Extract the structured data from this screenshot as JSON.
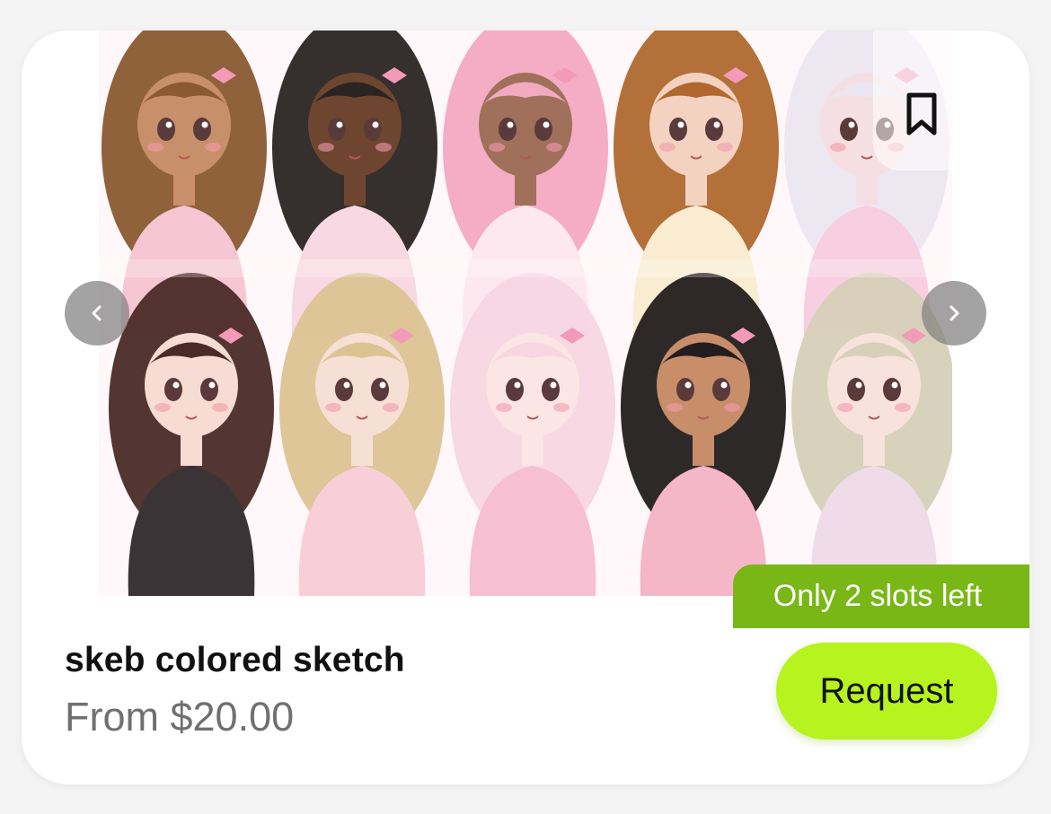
{
  "listing": {
    "title": "skeb colored sketch",
    "price": "From $20.00",
    "slots_badge": "Only 2 slots left",
    "request_label": "Request"
  },
  "icons": {
    "bookmark": "bookmark-icon",
    "prev": "chevron-left-icon",
    "next": "chevron-right-icon"
  },
  "colors": {
    "badge": "#78b716",
    "request": "#b6f31f",
    "nav": "#808080"
  },
  "gallery": {
    "characters": [
      {
        "hair": "#8a5a32",
        "skin": "#c8906a",
        "outfit": "#f6c6d4"
      },
      {
        "hair": "#2a2422",
        "skin": "#6e4630",
        "outfit": "#f8d8e2"
      },
      {
        "hair": "#f3a9c2",
        "skin": "#a0705a",
        "outfit": "#fde8ef"
      },
      {
        "hair": "#b0682e",
        "skin": "#f4d2c2",
        "outfit": "#f9ecd0"
      },
      {
        "hair": "#ece6f1",
        "skin": "#f6dfe2",
        "outfit": "#f7cfe0"
      },
      {
        "hair": "#4a2a26",
        "skin": "#f6dcd2",
        "outfit": "#3a3436"
      },
      {
        "hair": "#dcc392",
        "skin": "#f6dfd4",
        "outfit": "#f8cfd9"
      },
      {
        "hair": "#f7d6e2",
        "skin": "#fbe5e5",
        "outfit": "#f7bfd2"
      },
      {
        "hair": "#231d1d",
        "skin": "#c88e6a",
        "outfit": "#f5b6c8"
      },
      {
        "hair": "#d6d0b8",
        "skin": "#f8e2dc",
        "outfit": "#efdce8"
      }
    ]
  }
}
